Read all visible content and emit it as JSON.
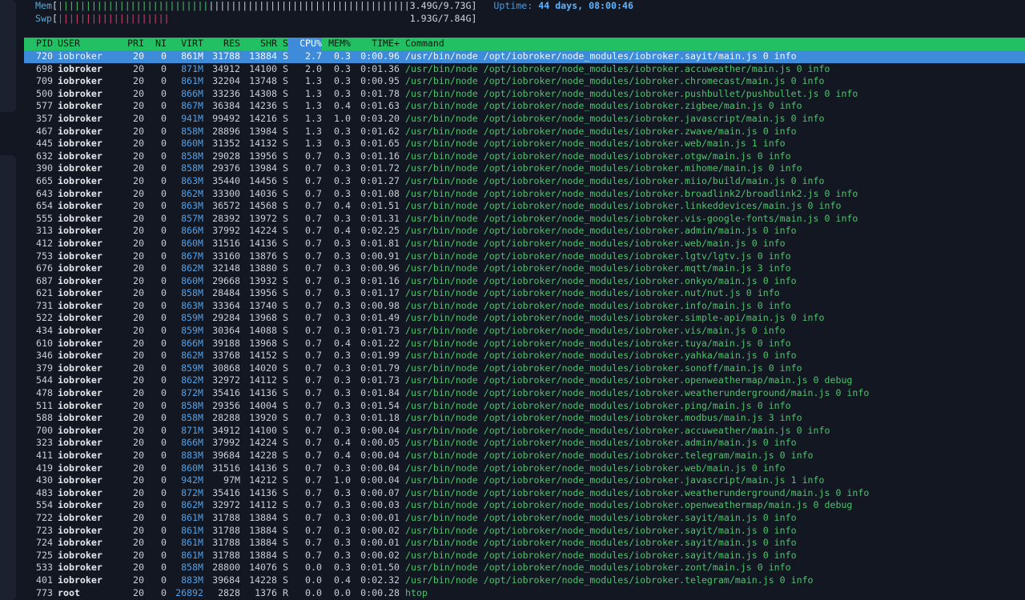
{
  "meters": {
    "mem": {
      "label": "Mem",
      "bar_used": "|||||||||||||||||||||||||||",
      "bar_rest": "||||||||||||||||||||||||||||||||||||",
      "value": "3.49G/9.73G"
    },
    "swp": {
      "label": "Swp",
      "bar_used": "||||||||||||||||||||",
      "value": "1.93G/7.84G"
    },
    "uptime": {
      "label": "Uptime:",
      "value": "44 days, 08:00:46"
    }
  },
  "columns": {
    "pid": "PID",
    "user": "USER",
    "pri": "PRI",
    "ni": "NI",
    "virt": "VIRT",
    "res": "RES",
    "shr": "SHR",
    "s": "S",
    "cpu": "CPU%",
    "mem": "MEM%",
    "time": "TIME+",
    "cmd": "Command"
  },
  "processes": [
    {
      "pid": "720",
      "user": "iobroker",
      "pri": "20",
      "ni": "0",
      "virt": "861M",
      "res": "31788",
      "shr": "13884",
      "s": "S",
      "cpu": "2.7",
      "mem": "0.3",
      "time": "0:00.96",
      "cmd": "/usr/bin/node /opt/iobroker/node_modules/iobroker.sayit/main.js 0 info"
    },
    {
      "pid": "698",
      "user": "iobroker",
      "pri": "20",
      "ni": "0",
      "virt": "871M",
      "res": "34912",
      "shr": "14100",
      "s": "S",
      "cpu": "2.0",
      "mem": "0.3",
      "time": "0:01.36",
      "cmd": "/usr/bin/node /opt/iobroker/node_modules/iobroker.accuweather/main.js 0 info"
    },
    {
      "pid": "709",
      "user": "iobroker",
      "pri": "20",
      "ni": "0",
      "virt": "861M",
      "res": "32204",
      "shr": "13748",
      "s": "S",
      "cpu": "1.3",
      "mem": "0.3",
      "time": "0:00.95",
      "cmd": "/usr/bin/node /opt/iobroker/node_modules/iobroker.chromecast/main.js 0 info"
    },
    {
      "pid": "500",
      "user": "iobroker",
      "pri": "20",
      "ni": "0",
      "virt": "866M",
      "res": "33236",
      "shr": "14308",
      "s": "S",
      "cpu": "1.3",
      "mem": "0.3",
      "time": "0:01.78",
      "cmd": "/usr/bin/node /opt/iobroker/node_modules/iobroker.pushbullet/pushbullet.js 0 info"
    },
    {
      "pid": "577",
      "user": "iobroker",
      "pri": "20",
      "ni": "0",
      "virt": "867M",
      "res": "36384",
      "shr": "14236",
      "s": "S",
      "cpu": "1.3",
      "mem": "0.4",
      "time": "0:01.63",
      "cmd": "/usr/bin/node /opt/iobroker/node_modules/iobroker.zigbee/main.js 0 info"
    },
    {
      "pid": "357",
      "user": "iobroker",
      "pri": "20",
      "ni": "0",
      "virt": "941M",
      "res": "99492",
      "shr": "14216",
      "s": "S",
      "cpu": "1.3",
      "mem": "1.0",
      "time": "0:03.20",
      "cmd": "/usr/bin/node /opt/iobroker/node_modules/iobroker.javascript/main.js 0 info"
    },
    {
      "pid": "467",
      "user": "iobroker",
      "pri": "20",
      "ni": "0",
      "virt": "858M",
      "res": "28896",
      "shr": "13984",
      "s": "S",
      "cpu": "1.3",
      "mem": "0.3",
      "time": "0:01.62",
      "cmd": "/usr/bin/node /opt/iobroker/node_modules/iobroker.zwave/main.js 0 info"
    },
    {
      "pid": "445",
      "user": "iobroker",
      "pri": "20",
      "ni": "0",
      "virt": "860M",
      "res": "31352",
      "shr": "14132",
      "s": "S",
      "cpu": "1.3",
      "mem": "0.3",
      "time": "0:01.65",
      "cmd": "/usr/bin/node /opt/iobroker/node_modules/iobroker.web/main.js 1 info"
    },
    {
      "pid": "632",
      "user": "iobroker",
      "pri": "20",
      "ni": "0",
      "virt": "858M",
      "res": "29028",
      "shr": "13956",
      "s": "S",
      "cpu": "0.7",
      "mem": "0.3",
      "time": "0:01.16",
      "cmd": "/usr/bin/node /opt/iobroker/node_modules/iobroker.otgw/main.js 0 info"
    },
    {
      "pid": "390",
      "user": "iobroker",
      "pri": "20",
      "ni": "0",
      "virt": "858M",
      "res": "29376",
      "shr": "13984",
      "s": "S",
      "cpu": "0.7",
      "mem": "0.3",
      "time": "0:01.72",
      "cmd": "/usr/bin/node /opt/iobroker/node_modules/iobroker.mihome/main.js 0 info"
    },
    {
      "pid": "665",
      "user": "iobroker",
      "pri": "20",
      "ni": "0",
      "virt": "863M",
      "res": "35440",
      "shr": "14456",
      "s": "S",
      "cpu": "0.7",
      "mem": "0.3",
      "time": "0:01.27",
      "cmd": "/usr/bin/node /opt/iobroker/node_modules/iobroker.miio/build/main.js 0 info"
    },
    {
      "pid": "643",
      "user": "iobroker",
      "pri": "20",
      "ni": "0",
      "virt": "862M",
      "res": "33300",
      "shr": "14036",
      "s": "S",
      "cpu": "0.7",
      "mem": "0.3",
      "time": "0:01.08",
      "cmd": "/usr/bin/node /opt/iobroker/node_modules/iobroker.broadlink2/broadlink2.js 0 info"
    },
    {
      "pid": "654",
      "user": "iobroker",
      "pri": "20",
      "ni": "0",
      "virt": "863M",
      "res": "36572",
      "shr": "14568",
      "s": "S",
      "cpu": "0.7",
      "mem": "0.4",
      "time": "0:01.51",
      "cmd": "/usr/bin/node /opt/iobroker/node_modules/iobroker.linkeddevices/main.js 0 info"
    },
    {
      "pid": "555",
      "user": "iobroker",
      "pri": "20",
      "ni": "0",
      "virt": "857M",
      "res": "28392",
      "shr": "13972",
      "s": "S",
      "cpu": "0.7",
      "mem": "0.3",
      "time": "0:01.31",
      "cmd": "/usr/bin/node /opt/iobroker/node_modules/iobroker.vis-google-fonts/main.js 0 info"
    },
    {
      "pid": "313",
      "user": "iobroker",
      "pri": "20",
      "ni": "0",
      "virt": "866M",
      "res": "37992",
      "shr": "14224",
      "s": "S",
      "cpu": "0.7",
      "mem": "0.4",
      "time": "0:02.25",
      "cmd": "/usr/bin/node /opt/iobroker/node_modules/iobroker.admin/main.js 0 info"
    },
    {
      "pid": "412",
      "user": "iobroker",
      "pri": "20",
      "ni": "0",
      "virt": "860M",
      "res": "31516",
      "shr": "14136",
      "s": "S",
      "cpu": "0.7",
      "mem": "0.3",
      "time": "0:01.81",
      "cmd": "/usr/bin/node /opt/iobroker/node_modules/iobroker.web/main.js 0 info"
    },
    {
      "pid": "753",
      "user": "iobroker",
      "pri": "20",
      "ni": "0",
      "virt": "867M",
      "res": "33160",
      "shr": "13876",
      "s": "S",
      "cpu": "0.7",
      "mem": "0.3",
      "time": "0:00.91",
      "cmd": "/usr/bin/node /opt/iobroker/node_modules/iobroker.lgtv/lgtv.js 0 info"
    },
    {
      "pid": "676",
      "user": "iobroker",
      "pri": "20",
      "ni": "0",
      "virt": "862M",
      "res": "32148",
      "shr": "13880",
      "s": "S",
      "cpu": "0.7",
      "mem": "0.3",
      "time": "0:00.96",
      "cmd": "/usr/bin/node /opt/iobroker/node_modules/iobroker.mqtt/main.js 3 info"
    },
    {
      "pid": "687",
      "user": "iobroker",
      "pri": "20",
      "ni": "0",
      "virt": "860M",
      "res": "29668",
      "shr": "13932",
      "s": "S",
      "cpu": "0.7",
      "mem": "0.3",
      "time": "0:01.16",
      "cmd": "/usr/bin/node /opt/iobroker/node_modules/iobroker.onkyo/main.js 0 info"
    },
    {
      "pid": "621",
      "user": "iobroker",
      "pri": "20",
      "ni": "0",
      "virt": "858M",
      "res": "28484",
      "shr": "13956",
      "s": "S",
      "cpu": "0.7",
      "mem": "0.3",
      "time": "0:01.17",
      "cmd": "/usr/bin/node /opt/iobroker/node_modules/iobroker.nut/nut.js 0 info"
    },
    {
      "pid": "731",
      "user": "iobroker",
      "pri": "20",
      "ni": "0",
      "virt": "863M",
      "res": "33364",
      "shr": "13740",
      "s": "S",
      "cpu": "0.7",
      "mem": "0.3",
      "time": "0:00.98",
      "cmd": "/usr/bin/node /opt/iobroker/node_modules/iobroker.info/main.js 0 info"
    },
    {
      "pid": "522",
      "user": "iobroker",
      "pri": "20",
      "ni": "0",
      "virt": "859M",
      "res": "29284",
      "shr": "13968",
      "s": "S",
      "cpu": "0.7",
      "mem": "0.3",
      "time": "0:01.49",
      "cmd": "/usr/bin/node /opt/iobroker/node_modules/iobroker.simple-api/main.js 0 info"
    },
    {
      "pid": "434",
      "user": "iobroker",
      "pri": "20",
      "ni": "0",
      "virt": "859M",
      "res": "30364",
      "shr": "14088",
      "s": "S",
      "cpu": "0.7",
      "mem": "0.3",
      "time": "0:01.73",
      "cmd": "/usr/bin/node /opt/iobroker/node_modules/iobroker.vis/main.js 0 info"
    },
    {
      "pid": "610",
      "user": "iobroker",
      "pri": "20",
      "ni": "0",
      "virt": "866M",
      "res": "39188",
      "shr": "13968",
      "s": "S",
      "cpu": "0.7",
      "mem": "0.4",
      "time": "0:01.22",
      "cmd": "/usr/bin/node /opt/iobroker/node_modules/iobroker.tuya/main.js 0 info"
    },
    {
      "pid": "346",
      "user": "iobroker",
      "pri": "20",
      "ni": "0",
      "virt": "862M",
      "res": "33768",
      "shr": "14152",
      "s": "S",
      "cpu": "0.7",
      "mem": "0.3",
      "time": "0:01.99",
      "cmd": "/usr/bin/node /opt/iobroker/node_modules/iobroker.yahka/main.js 0 info"
    },
    {
      "pid": "379",
      "user": "iobroker",
      "pri": "20",
      "ni": "0",
      "virt": "859M",
      "res": "30868",
      "shr": "14020",
      "s": "S",
      "cpu": "0.7",
      "mem": "0.3",
      "time": "0:01.79",
      "cmd": "/usr/bin/node /opt/iobroker/node_modules/iobroker.sonoff/main.js 0 info"
    },
    {
      "pid": "544",
      "user": "iobroker",
      "pri": "20",
      "ni": "0",
      "virt": "862M",
      "res": "32972",
      "shr": "14112",
      "s": "S",
      "cpu": "0.7",
      "mem": "0.3",
      "time": "0:01.73",
      "cmd": "/usr/bin/node /opt/iobroker/node_modules/iobroker.openweathermap/main.js 0 debug"
    },
    {
      "pid": "478",
      "user": "iobroker",
      "pri": "20",
      "ni": "0",
      "virt": "872M",
      "res": "35416",
      "shr": "14136",
      "s": "S",
      "cpu": "0.7",
      "mem": "0.3",
      "time": "0:01.84",
      "cmd": "/usr/bin/node /opt/iobroker/node_modules/iobroker.weatherunderground/main.js 0 info"
    },
    {
      "pid": "511",
      "user": "iobroker",
      "pri": "20",
      "ni": "0",
      "virt": "858M",
      "res": "29356",
      "shr": "14004",
      "s": "S",
      "cpu": "0.7",
      "mem": "0.3",
      "time": "0:01.54",
      "cmd": "/usr/bin/node /opt/iobroker/node_modules/iobroker.ping/main.js 0 info"
    },
    {
      "pid": "588",
      "user": "iobroker",
      "pri": "20",
      "ni": "0",
      "virt": "858M",
      "res": "28288",
      "shr": "13920",
      "s": "S",
      "cpu": "0.7",
      "mem": "0.3",
      "time": "0:01.18",
      "cmd": "/usr/bin/node /opt/iobroker/node_modules/iobroker.modbus/main.js 3 info"
    },
    {
      "pid": "700",
      "user": "iobroker",
      "pri": "20",
      "ni": "0",
      "virt": "871M",
      "res": "34912",
      "shr": "14100",
      "s": "S",
      "cpu": "0.7",
      "mem": "0.3",
      "time": "0:00.04",
      "cmd": "/usr/bin/node /opt/iobroker/node_modules/iobroker.accuweather/main.js 0 info"
    },
    {
      "pid": "323",
      "user": "iobroker",
      "pri": "20",
      "ni": "0",
      "virt": "866M",
      "res": "37992",
      "shr": "14224",
      "s": "S",
      "cpu": "0.7",
      "mem": "0.4",
      "time": "0:00.05",
      "cmd": "/usr/bin/node /opt/iobroker/node_modules/iobroker.admin/main.js 0 info"
    },
    {
      "pid": "411",
      "user": "iobroker",
      "pri": "20",
      "ni": "0",
      "virt": "883M",
      "res": "39684",
      "shr": "14228",
      "s": "S",
      "cpu": "0.7",
      "mem": "0.4",
      "time": "0:00.04",
      "cmd": "/usr/bin/node /opt/iobroker/node_modules/iobroker.telegram/main.js 0 info"
    },
    {
      "pid": "419",
      "user": "iobroker",
      "pri": "20",
      "ni": "0",
      "virt": "860M",
      "res": "31516",
      "shr": "14136",
      "s": "S",
      "cpu": "0.7",
      "mem": "0.3",
      "time": "0:00.04",
      "cmd": "/usr/bin/node /opt/iobroker/node_modules/iobroker.web/main.js 0 info"
    },
    {
      "pid": "430",
      "user": "iobroker",
      "pri": "20",
      "ni": "0",
      "virt": "942M",
      "res": "97M",
      "shr": "14212",
      "s": "S",
      "cpu": "0.7",
      "mem": "1.0",
      "time": "0:00.04",
      "cmd": "/usr/bin/node /opt/iobroker/node_modules/iobroker.javascript/main.js 1 info"
    },
    {
      "pid": "483",
      "user": "iobroker",
      "pri": "20",
      "ni": "0",
      "virt": "872M",
      "res": "35416",
      "shr": "14136",
      "s": "S",
      "cpu": "0.7",
      "mem": "0.3",
      "time": "0:00.07",
      "cmd": "/usr/bin/node /opt/iobroker/node_modules/iobroker.weatherunderground/main.js 0 info"
    },
    {
      "pid": "554",
      "user": "iobroker",
      "pri": "20",
      "ni": "0",
      "virt": "862M",
      "res": "32972",
      "shr": "14112",
      "s": "S",
      "cpu": "0.7",
      "mem": "0.3",
      "time": "0:00.03",
      "cmd": "/usr/bin/node /opt/iobroker/node_modules/iobroker.openweathermap/main.js 0 debug"
    },
    {
      "pid": "722",
      "user": "iobroker",
      "pri": "20",
      "ni": "0",
      "virt": "861M",
      "res": "31788",
      "shr": "13884",
      "s": "S",
      "cpu": "0.7",
      "mem": "0.3",
      "time": "0:00.01",
      "cmd": "/usr/bin/node /opt/iobroker/node_modules/iobroker.sayit/main.js 0 info"
    },
    {
      "pid": "723",
      "user": "iobroker",
      "pri": "20",
      "ni": "0",
      "virt": "861M",
      "res": "31788",
      "shr": "13884",
      "s": "S",
      "cpu": "0.7",
      "mem": "0.3",
      "time": "0:00.02",
      "cmd": "/usr/bin/node /opt/iobroker/node_modules/iobroker.sayit/main.js 0 info"
    },
    {
      "pid": "724",
      "user": "iobroker",
      "pri": "20",
      "ni": "0",
      "virt": "861M",
      "res": "31788",
      "shr": "13884",
      "s": "S",
      "cpu": "0.7",
      "mem": "0.3",
      "time": "0:00.01",
      "cmd": "/usr/bin/node /opt/iobroker/node_modules/iobroker.sayit/main.js 0 info"
    },
    {
      "pid": "725",
      "user": "iobroker",
      "pri": "20",
      "ni": "0",
      "virt": "861M",
      "res": "31788",
      "shr": "13884",
      "s": "S",
      "cpu": "0.7",
      "mem": "0.3",
      "time": "0:00.02",
      "cmd": "/usr/bin/node /opt/iobroker/node_modules/iobroker.sayit/main.js 0 info"
    },
    {
      "pid": "533",
      "user": "iobroker",
      "pri": "20",
      "ni": "0",
      "virt": "858M",
      "res": "28800",
      "shr": "14076",
      "s": "S",
      "cpu": "0.0",
      "mem": "0.3",
      "time": "0:01.50",
      "cmd": "/usr/bin/node /opt/iobroker/node_modules/iobroker.zont/main.js 0 info"
    },
    {
      "pid": "401",
      "user": "iobroker",
      "pri": "20",
      "ni": "0",
      "virt": "883M",
      "res": "39684",
      "shr": "14228",
      "s": "S",
      "cpu": "0.0",
      "mem": "0.4",
      "time": "0:02.32",
      "cmd": "/usr/bin/node /opt/iobroker/node_modules/iobroker.telegram/main.js 0 info"
    },
    {
      "pid": "773",
      "user": "root",
      "pri": "20",
      "ni": "0",
      "virt": "26892",
      "res": "2828",
      "shr": "1376",
      "s": "R",
      "cpu": "0.0",
      "mem": "0.0",
      "time": "0:00.28",
      "cmd": "htop"
    }
  ]
}
